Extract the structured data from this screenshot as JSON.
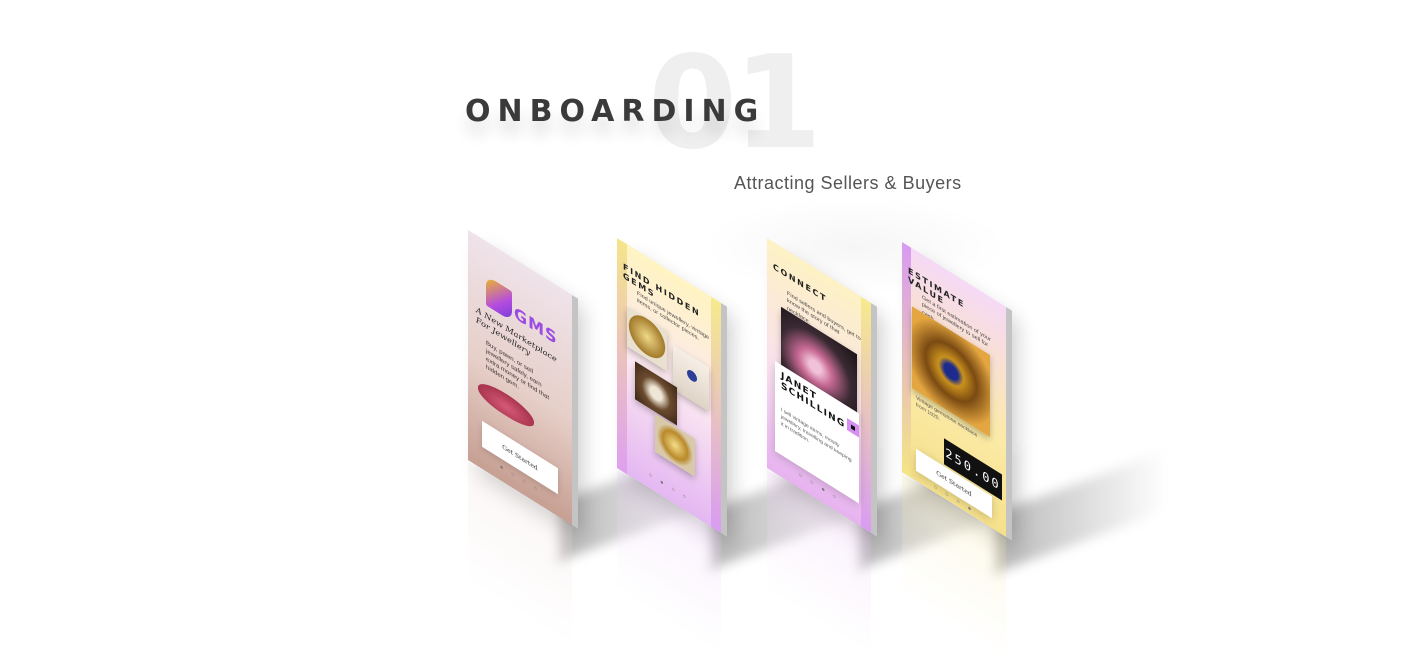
{
  "section": {
    "number": "01",
    "title": "ONBOARDING",
    "subtitle": "Attracting Sellers & Buyers"
  },
  "screens": [
    {
      "logo_text": "GMS",
      "tagline": "A New Marketplace For Jewellery",
      "body": "Buy, pawn, or sell jewellery safely, earn extra money or find that hidden gem.",
      "cta": "Get Started",
      "pagination": "● ○ ○ ○"
    },
    {
      "title": "FIND HIDDEN GEMS",
      "body": "Find unique jewellery, vintage items, or collector pieces.",
      "pagination": "○ ● ○ ○"
    },
    {
      "title": "CONNECT",
      "body": "Find sellers and buyers, get to know the story of that necklace.",
      "name": "JANET SCHILLING",
      "desc": "I sell vintage items, mostly jewellery, travelling and keeping it in tradition.",
      "pagination": "○ ○ ● ○"
    },
    {
      "title": "ESTIMATE VALUE",
      "body": "Get a first estimation of your piece of jewellery to sell for cash.",
      "caption": "Vintage gemstone necklace from 1920.",
      "value": "250.00",
      "cta": "Get Started",
      "pagination": "○ ○ ○ ●"
    }
  ],
  "colors": {
    "accent_purple": "#b54ce0",
    "accent_yellow": "#f5e485",
    "heading": "#3a3a3a"
  }
}
